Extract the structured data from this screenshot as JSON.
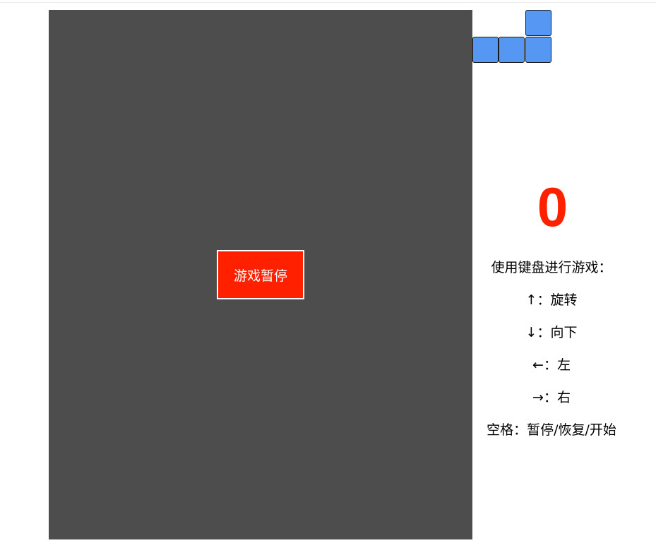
{
  "pause_overlay": {
    "label": "游戏暂停"
  },
  "next_piece": {
    "color": "#5597f2",
    "cells": [
      [
        0,
        2
      ],
      [
        1,
        0
      ],
      [
        1,
        1
      ],
      [
        1,
        2
      ]
    ]
  },
  "score": {
    "value": "0",
    "color": "#ff2000"
  },
  "instructions": {
    "heading": "使用键盘进行游戏：",
    "lines": [
      "↑：旋转",
      "↓：向下",
      "←：左",
      "→：右",
      "空格：暂停/恢复/开始"
    ]
  },
  "colors": {
    "board": "#4d4d4d",
    "overlay": "#ff2000",
    "block": "#5597f2"
  }
}
